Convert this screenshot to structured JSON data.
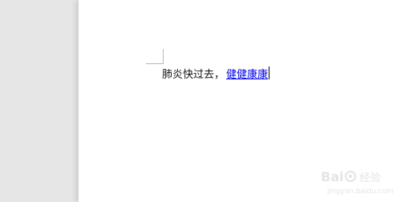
{
  "document": {
    "plain_text": "肺炎快过去，",
    "link_text": "健健康康"
  },
  "watermark": {
    "brand": "Bai",
    "brand_suffix": "经验",
    "url": "jingyan.baidu.com"
  }
}
